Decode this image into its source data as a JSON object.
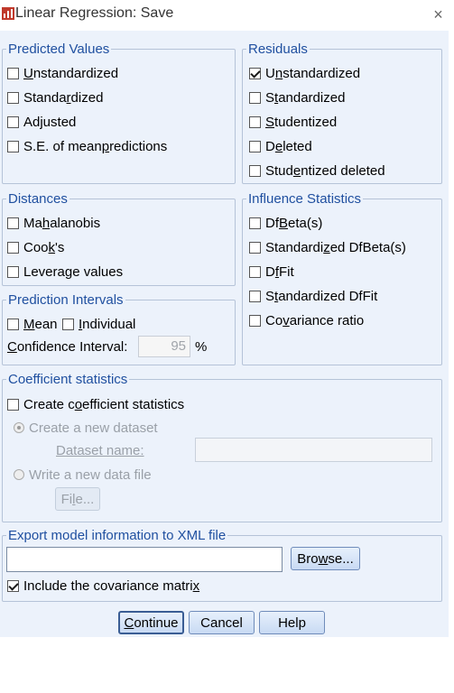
{
  "window": {
    "title": "Linear Regression: Save",
    "close_symbol": "×"
  },
  "predicted_values": {
    "legend": "Predicted Values",
    "items": [
      {
        "pre": "",
        "key": "U",
        "post": "nstandardized",
        "checked": false
      },
      {
        "pre": "Standa",
        "key": "r",
        "post": "dized",
        "checked": false
      },
      {
        "pre": "Adjusted",
        "key": "",
        "post": "",
        "checked": false
      },
      {
        "pre": "S.E. of mean ",
        "key": "p",
        "post": "redictions",
        "checked": false
      }
    ]
  },
  "residuals": {
    "legend": "Residuals",
    "items": [
      {
        "pre": "U",
        "key": "n",
        "post": "standardized",
        "checked": true
      },
      {
        "pre": "S",
        "key": "t",
        "post": "andardized",
        "checked": false
      },
      {
        "pre": "",
        "key": "S",
        "post": "tudentized",
        "checked": false
      },
      {
        "pre": "D",
        "key": "e",
        "post": "leted",
        "checked": false
      },
      {
        "pre": "Stud",
        "key": "e",
        "post": "ntized deleted",
        "checked": false
      }
    ]
  },
  "distances": {
    "legend": "Distances",
    "items": [
      {
        "pre": "Ma",
        "key": "h",
        "post": "alanobis",
        "checked": false
      },
      {
        "pre": "Coo",
        "key": "k",
        "post": "'s",
        "checked": false
      },
      {
        "pre": "Levera",
        "key": "g",
        "post": "e values",
        "checked": false
      }
    ]
  },
  "influence": {
    "legend": "Influence Statistics",
    "items": [
      {
        "pre": "Df",
        "key": "B",
        "post": "eta(s)",
        "checked": false
      },
      {
        "pre": "Standardi",
        "key": "z",
        "post": "ed DfBeta(s)",
        "checked": false
      },
      {
        "pre": "D",
        "key": "f",
        "post": "Fit",
        "checked": false
      },
      {
        "pre": "S",
        "key": "t",
        "post": "andardized DfFit",
        "checked": false
      },
      {
        "pre": "Co",
        "key": "v",
        "post": "ariance ratio",
        "checked": false
      }
    ]
  },
  "prediction_intervals": {
    "legend": "Prediction Intervals",
    "mean": {
      "pre": "",
      "key": "M",
      "post": "ean",
      "checked": false
    },
    "individual": {
      "pre": "",
      "key": "I",
      "post": "ndividual",
      "checked": false
    },
    "ci_label_key": "C",
    "ci_label_post": "onfidence Interval:",
    "ci_value": "95",
    "ci_unit": "%"
  },
  "coefficient": {
    "legend": "Coefficient statistics",
    "create": {
      "pre": "Create c",
      "key": "o",
      "post": "efficient statistics",
      "checked": false
    },
    "new_dataset": "Create a new dataset",
    "dataset_name_label": "Dataset name:",
    "write_file": "Write a new data file",
    "file_button_pre": "Fi",
    "file_button_key": "l",
    "file_button_post": "e..."
  },
  "export": {
    "legend": "Export model information to XML file",
    "browse_pre": "Bro",
    "browse_key": "w",
    "browse_post": "se...",
    "include": {
      "pre": "Include the covariance matri",
      "key": "x",
      "post": "",
      "checked": true
    }
  },
  "buttons": {
    "continue_key": "C",
    "continue_post": "ontinue",
    "cancel": "Cancel",
    "help": "Help"
  }
}
